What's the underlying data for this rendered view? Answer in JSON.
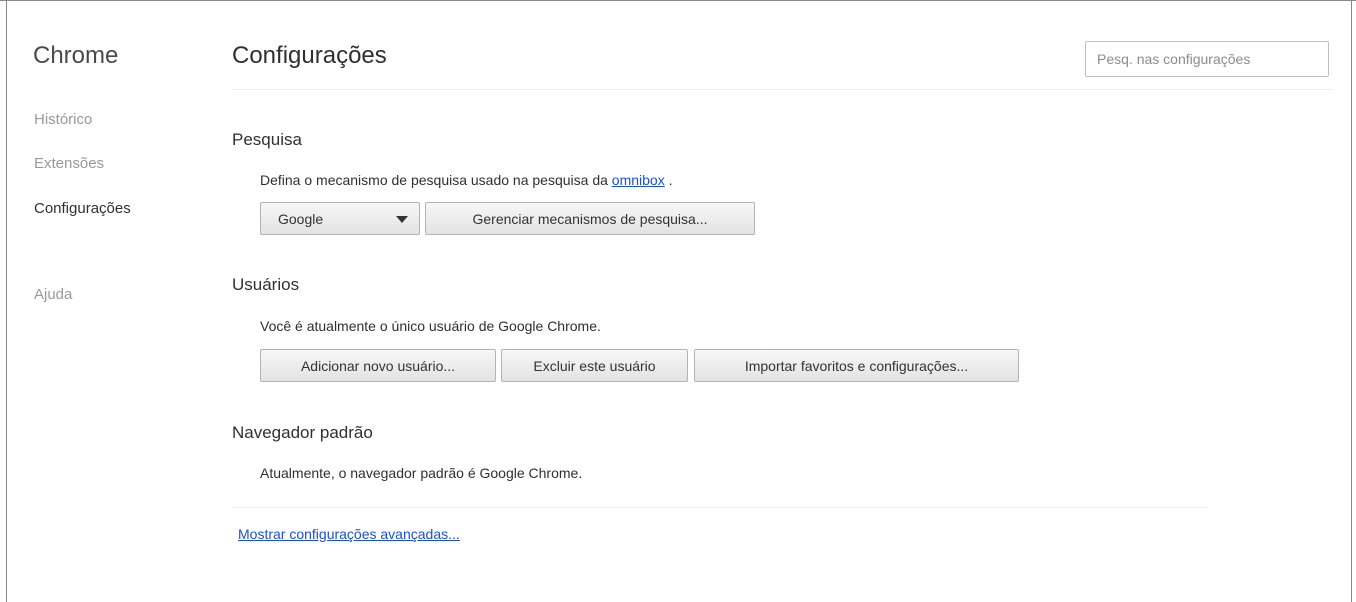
{
  "sidebar": {
    "title": "Chrome",
    "items": [
      {
        "label": "Histórico"
      },
      {
        "label": "Extensões"
      },
      {
        "label": "Configurações",
        "selected": true
      },
      {
        "label": "Ajuda"
      }
    ]
  },
  "header": {
    "title": "Configurações",
    "search_placeholder": "Pesq. nas configurações"
  },
  "sections": {
    "search": {
      "title": "Pesquisa",
      "description": "Defina o mecanismo de pesquisa usado na pesquisa da",
      "link_text": "omnibox",
      "description_end": " .",
      "engine_selected": "Google",
      "manage_button": "Gerenciar mecanismos de pesquisa..."
    },
    "users": {
      "title": "Usuários",
      "description": "Você é atualmente o único usuário de Google Chrome.",
      "add_button": "Adicionar novo usuário...",
      "delete_button": "Excluir este usuário",
      "import_button": "Importar favoritos e configurações..."
    },
    "default_browser": {
      "title": "Navegador padrão",
      "description": "Atualmente, o navegador padrão é Google Chrome."
    }
  },
  "footer": {
    "advanced_link": "Mostrar configurações avançadas..."
  },
  "colors": {
    "link": "#1a4fdd",
    "text": "#303030",
    "muted": "#999999"
  }
}
